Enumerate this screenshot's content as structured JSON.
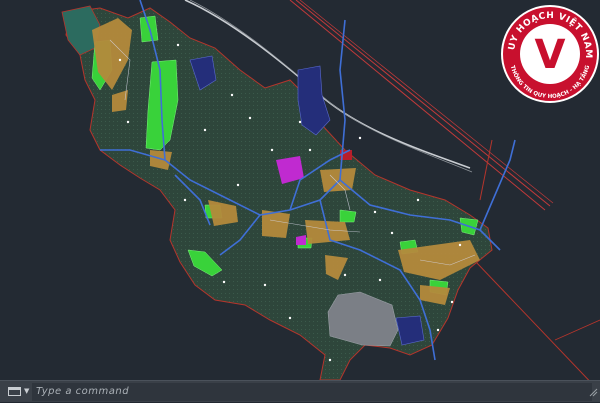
{
  "command_line": {
    "placeholder": "Type a command",
    "icon": "command-line-icon"
  },
  "logo": {
    "top_text": "QUY HOẠCH VIỆT NAM",
    "bottom_text": "THÔNG TIN QUY HOẠCH - HẠ TẦNG",
    "letter": "V",
    "colors": {
      "ring": "#c8102e",
      "inner": "#ffffff",
      "letter": "#c8102e"
    }
  },
  "map_colors": {
    "territory": "#2f4a3e",
    "boundary": "#b5352c",
    "roads": "#3f6fd6",
    "settlement": "#b48a3c",
    "green": "#39d23a",
    "magenta": "#c02ad0",
    "navy": "#242e7a",
    "gray_zone": "#7b7f86",
    "rail": "#c23a3a"
  }
}
